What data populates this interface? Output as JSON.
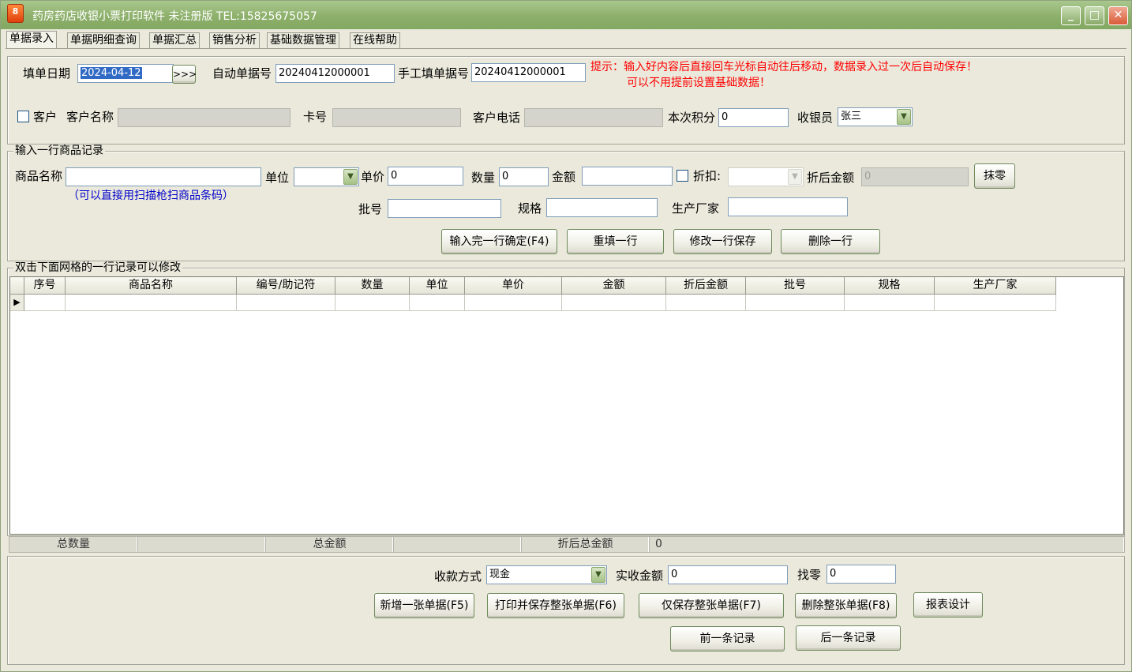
{
  "window": {
    "icon_glyph": "8",
    "title": "药房药店收银小票打印软件 未注册版 TEL:15825675057",
    "controls": {
      "minimize": "_",
      "maximize": "□",
      "close": "✕"
    }
  },
  "tabs": [
    "单据录入",
    "单据明细查询",
    "单据汇总",
    "销售分析",
    "基础数据管理",
    "在线帮助"
  ],
  "header": {
    "date_label": "填单日期",
    "date_value": "2024-04-12",
    "date_button": ">>>",
    "auto_no_label": "自动单据号",
    "auto_no_value": "20240412000001",
    "manual_no_label": "手工填单据号",
    "manual_no_value": "20240412000001",
    "tip_line1": "提示：输入好内容后直接回车光标自动往后移动，数据录入过一次后自动保存！",
    "tip_line2": "可以不用提前设置基础数据！",
    "customer_checkbox_label": "客户",
    "customer_name_label": "客户名称",
    "customer_name_value": "",
    "card_label": "卡号",
    "card_value": "",
    "phone_label": "客户电话",
    "phone_value": "",
    "points_label": "本次积分",
    "points_value": "0",
    "cashier_label": "收银员",
    "cashier_value": "张三"
  },
  "item_entry": {
    "legend": "输入一行商品记录",
    "name_label": "商品名称",
    "name_value": "",
    "scan_hint": "（可以直接用扫描枪扫商品条码）",
    "unit_label": "单位",
    "unit_value": "",
    "price_label": "单价",
    "price_value": "0",
    "qty_label": "数量",
    "qty_value": "0",
    "amount_label": "金额",
    "amount_value": "",
    "discount_label": "折扣:",
    "discount_value": "",
    "after_discount_label": "折后金额",
    "after_discount_value": "0",
    "round_button": "抹零",
    "batch_label": "批号",
    "batch_value": "",
    "spec_label": "规格",
    "spec_value": "",
    "maker_label": "生产厂家",
    "maker_value": "",
    "confirm_button": "输入完一行确定(F4)",
    "reset_button": "重填一行",
    "save_edit_button": "修改一行保存",
    "delete_row_button": "删除一行"
  },
  "grid": {
    "legend": "双击下面网格的一行记录可以修改",
    "columns": [
      "序号",
      "商品名称",
      "编号/助记符",
      "数量",
      "单位",
      "单价",
      "金额",
      "折后金额",
      "批号",
      "规格",
      "生产厂家"
    ],
    "row_pointer": "▶"
  },
  "totals": {
    "total_qty_label": "总数量",
    "total_qty_value": "",
    "total_amount_label": "总金额",
    "total_amount_value": "",
    "discount_total_label": "折后总金额",
    "discount_total_value": "0"
  },
  "payment": {
    "method_label": "收款方式",
    "method_value": "现金",
    "received_label": "实收金额",
    "received_value": "0",
    "change_label": "找零",
    "change_value": "0"
  },
  "actions": {
    "new_bill": "新增一张单据(F5)",
    "print_save": "打印并保存整张单据(F6)",
    "save_only": "仅保存整张单据(F7)",
    "delete_bill": "删除整张单据(F8)",
    "report_design": "报表设计",
    "prev_record": "前一条记录",
    "next_record": "后一条记录"
  },
  "colors": {
    "titlebar": "#8db06b",
    "tip_text": "#ff0000",
    "hint_text": "#0000cc",
    "selection": "#316ac5"
  },
  "icons": [
    "app-icon",
    "calendar-button",
    "dropdown-arrow-icon",
    "row-pointer-icon"
  ]
}
